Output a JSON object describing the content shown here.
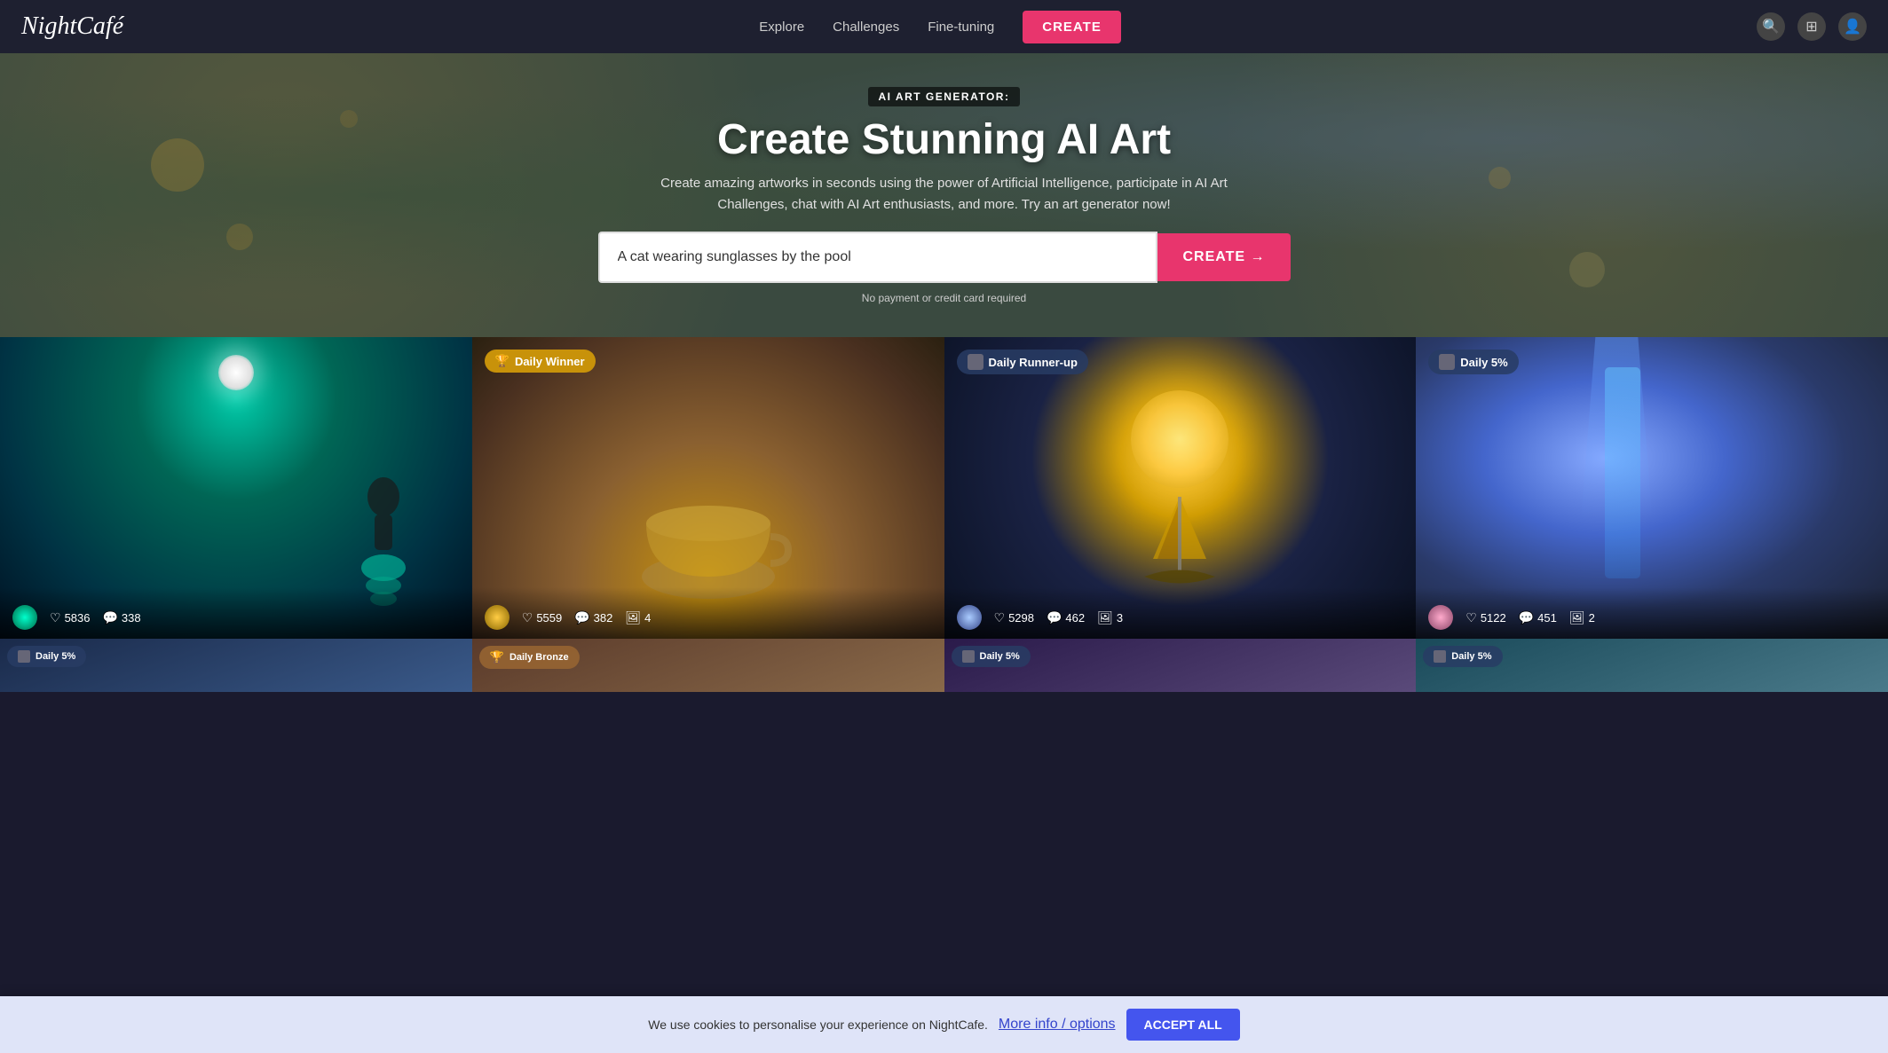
{
  "header": {
    "logo": "NightCafé",
    "nav": {
      "explore": "Explore",
      "challenges": "Challenges",
      "fine_tuning": "Fine-tuning",
      "create_btn": "CREATE"
    },
    "icons": {
      "search": "🔍",
      "app": "⊞",
      "user": "👤"
    }
  },
  "hero": {
    "badge": "AI ART GENERATOR:",
    "title": "Create Stunning AI Art",
    "subtitle": "Create amazing artworks in seconds using the power of Artificial Intelligence, participate in AI Art Challenges, chat with AI Art enthusiasts, and more. Try an art generator now!",
    "input_value": "A cat wearing sunglasses by the pool",
    "input_placeholder": "A cat wearing sunglasses by the pool",
    "create_btn": "CREATE →",
    "note": "No payment or credit card required"
  },
  "gallery": {
    "items": [
      {
        "id": 1,
        "badge": null,
        "likes": "5836",
        "comments": "338",
        "images": null
      },
      {
        "id": 2,
        "badge_type": "winner",
        "badge_icon": "🏆",
        "badge_label": "Daily Winner",
        "likes": "5559",
        "comments": "382",
        "images": "4"
      },
      {
        "id": 3,
        "badge_type": "runner",
        "badge_icon": "🤖",
        "badge_label": "Daily Runner-up",
        "likes": "5298",
        "comments": "462",
        "images": "3"
      },
      {
        "id": 4,
        "badge_type": "daily",
        "badge_icon": "🤖",
        "badge_label": "Daily 5%",
        "likes": "5122",
        "comments": "451",
        "images": "2"
      }
    ],
    "row2": [
      {
        "id": 5,
        "badge_type": "daily",
        "badge_icon": "🤖",
        "badge_label": "Daily 5%"
      },
      {
        "id": 6,
        "badge_type": "bronze",
        "badge_icon": "🏆",
        "badge_label": "Daily Bronze"
      },
      {
        "id": 7,
        "badge_type": "daily",
        "badge_icon": "🤖",
        "badge_label": "Daily 5%"
      },
      {
        "id": 8,
        "badge_type": "daily",
        "badge_icon": "🤖",
        "badge_label": "Daily 5%"
      }
    ]
  },
  "cookie": {
    "text": "We use cookies to personalise your experience on NightCafe.",
    "link": "More info / options",
    "accept_btn": "ACCEPT ALL"
  }
}
